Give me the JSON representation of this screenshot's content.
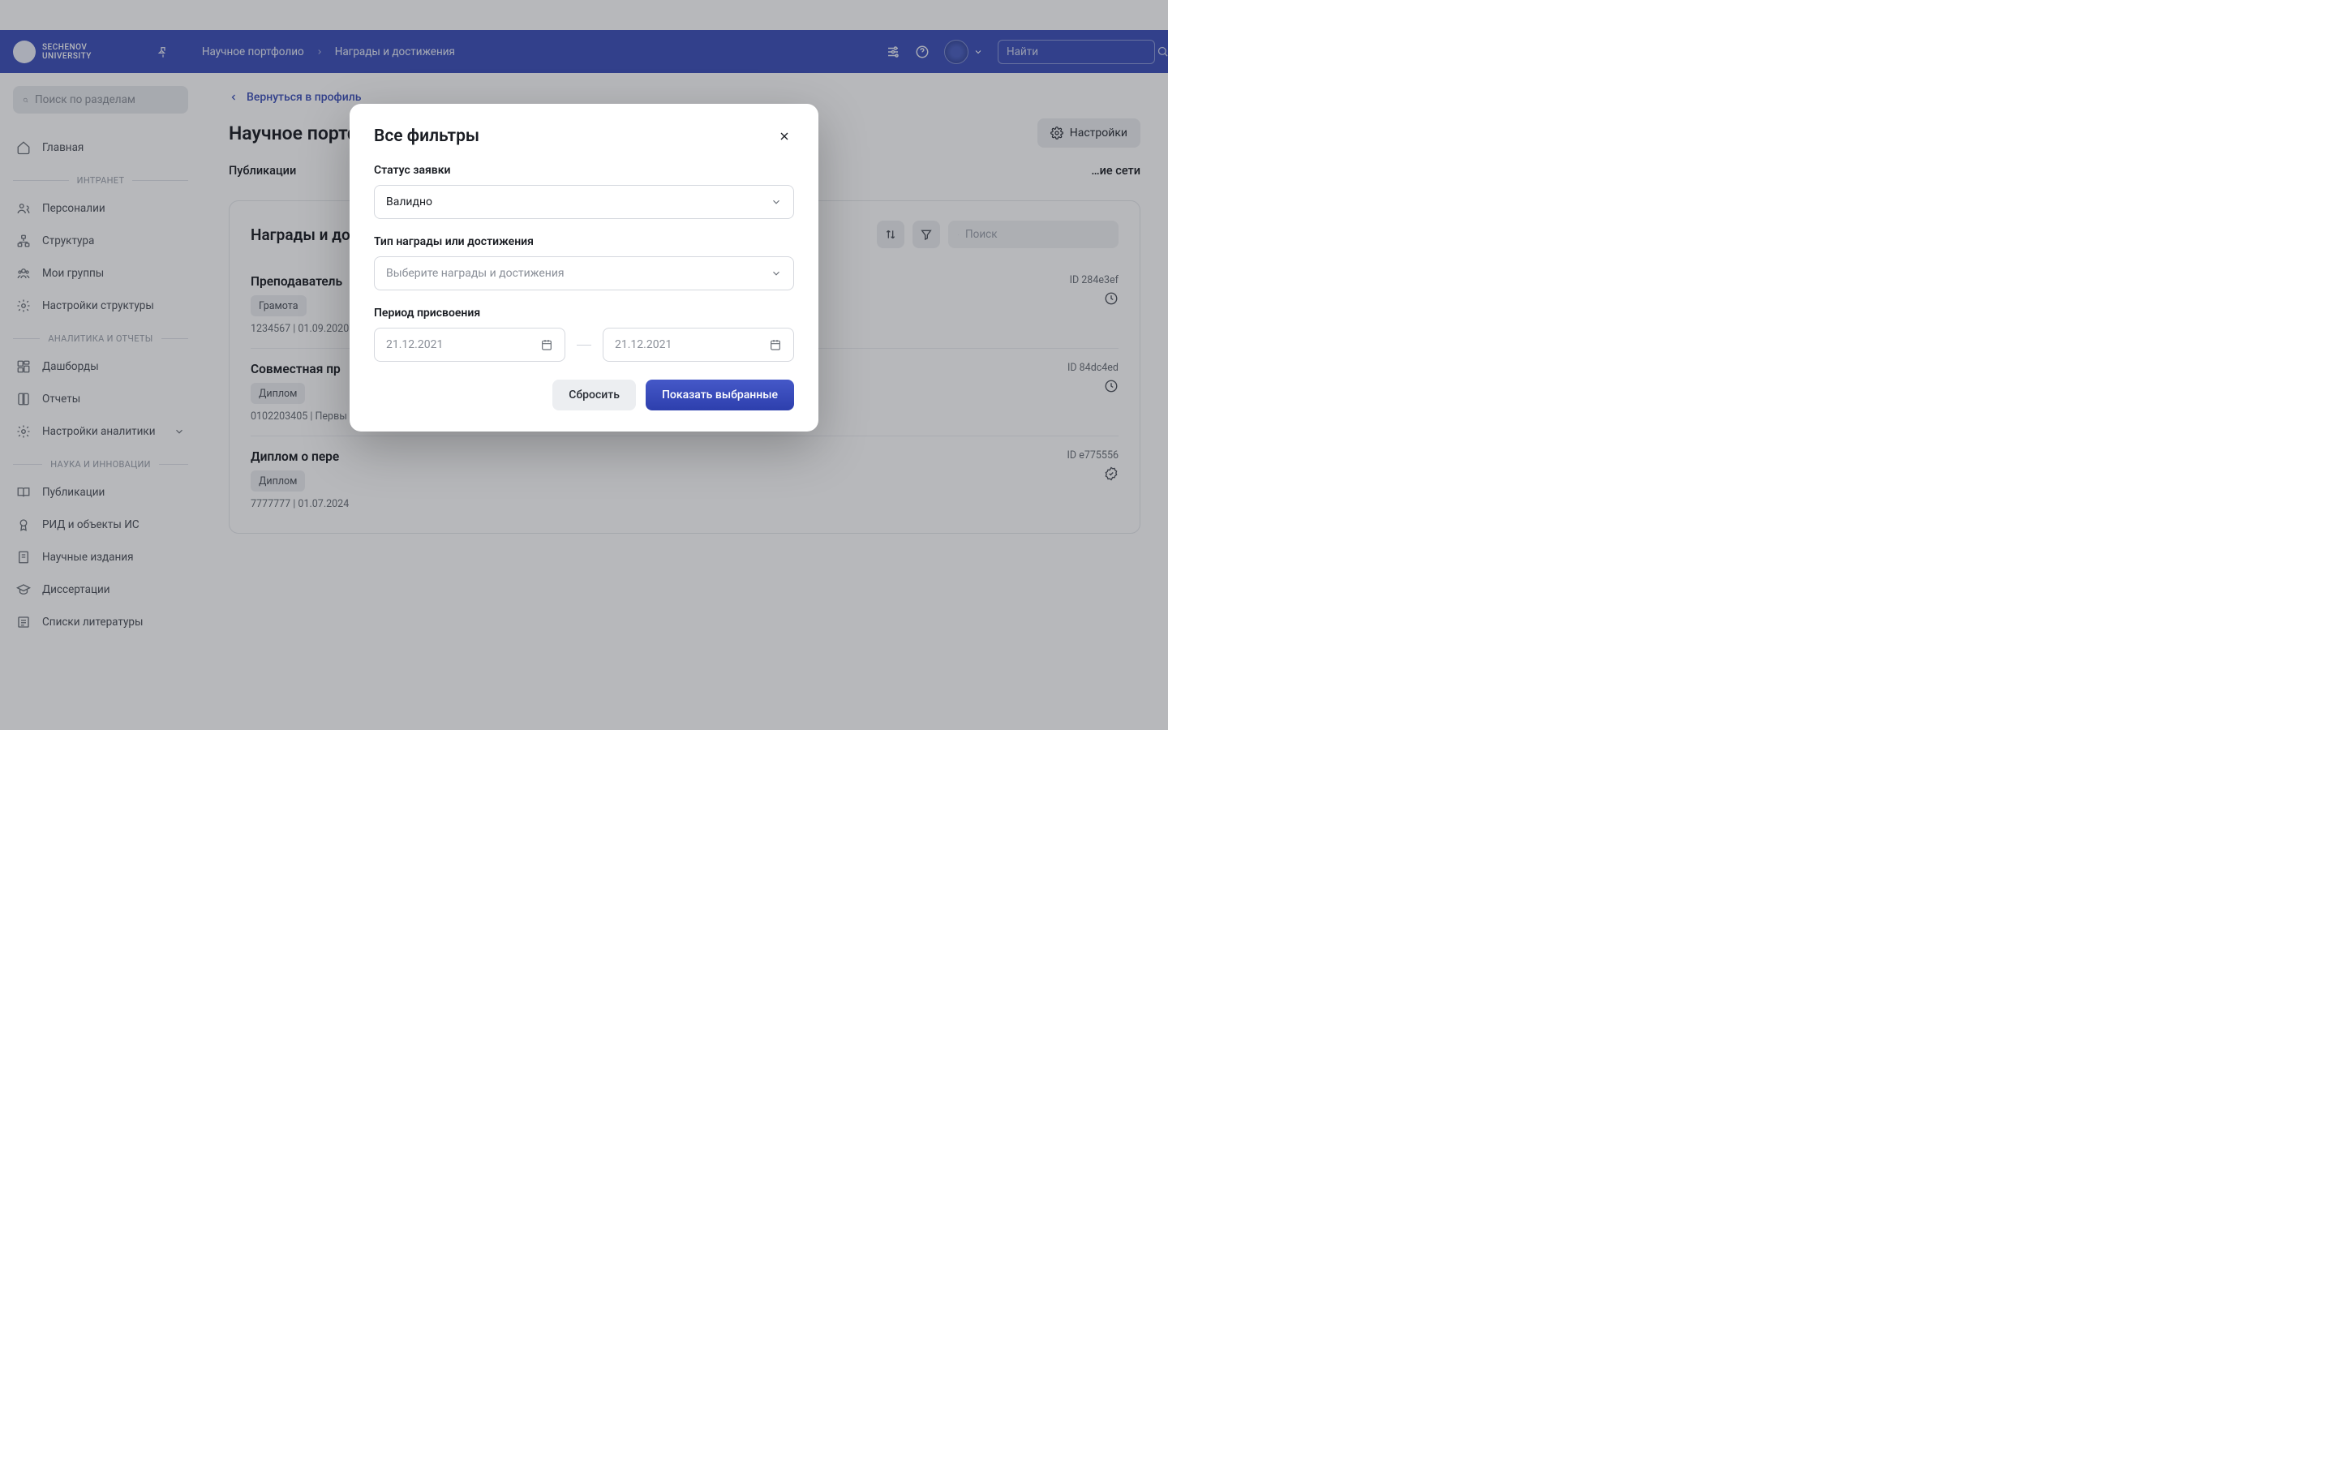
{
  "header": {
    "brand1": "SECHENOV",
    "brand2": "UNIVERSITY",
    "crumb1": "Научное портфолио",
    "crumb2": "Награды и достижения",
    "search_placeholder": "Найти"
  },
  "sidebar": {
    "search_placeholder": "Поиск по разделам",
    "home": "Главная",
    "group_intranet": "ИНТРАНЕТ",
    "item_persons": "Персоналии",
    "item_structure": "Структура",
    "item_groups": "Мои группы",
    "item_struct_settings": "Настройки структуры",
    "group_analytics": "АНАЛИТИКА И ОТЧЕТЫ",
    "item_dashboards": "Дашборды",
    "item_reports": "Отчеты",
    "item_analytics_settings": "Настройки аналитики",
    "group_science": "НАУКА И ИННОВАЦИИ",
    "item_pubs": "Публикации",
    "item_rid": "РИД и объекты ИС",
    "item_editions": "Научные издания",
    "item_diss": "Диссертации",
    "item_lists": "Списки литературы"
  },
  "main": {
    "back": "Вернуться в профиль",
    "title": "Научное портфолио",
    "settings": "Настройки",
    "tab_pubs": "Публикации",
    "tab_other": "…ие сети",
    "panel_title": "Награды и до",
    "search_placeholder": "Поиск",
    "rows": [
      {
        "title": "Преподаватель",
        "badge": "Грамота",
        "meta": "1234567 | 01.09.2020",
        "id": "ID 284e3ef",
        "status": "pending"
      },
      {
        "title": "Совместная пр",
        "badge": "Диплом",
        "meta": "0102203405 | Первы",
        "id": "ID 84dc4ed",
        "status": "pending"
      },
      {
        "title": "Диплом о пере",
        "badge": "Диплом",
        "meta": "7777777 | 01.07.2024",
        "id": "ID e775556",
        "status": "verified"
      }
    ]
  },
  "modal": {
    "title": "Все фильтры",
    "field_status": "Статус заявки",
    "status_value": "Валидно",
    "field_type": "Тип награды или достижения",
    "type_placeholder": "Выберите награды и достижения",
    "field_period": "Период присвоения",
    "date_placeholder": "21.12.2021",
    "reset": "Сбросить",
    "apply": "Показать выбранные"
  }
}
